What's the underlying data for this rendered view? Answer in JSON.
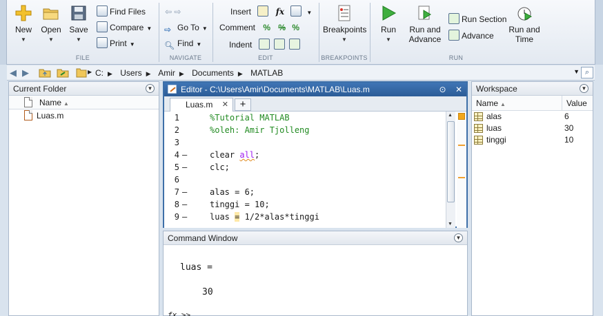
{
  "toolstrip": {
    "file": {
      "label": "FILE",
      "new": "New",
      "open": "Open",
      "save": "Save",
      "find_files": "Find Files",
      "compare": "Compare",
      "print": "Print"
    },
    "navigate": {
      "label": "NAVIGATE",
      "go_to": "Go To",
      "find": "Find"
    },
    "edit": {
      "label": "EDIT",
      "insert": "Insert",
      "comment": "Comment",
      "indent": "Indent",
      "fx": "fx"
    },
    "breakpoints": {
      "label": "BREAKPOINTS",
      "breakpoints": "Breakpoints"
    },
    "run": {
      "label": "RUN",
      "run": "Run",
      "run_and_advance_1": "Run and",
      "run_and_advance_2": "Advance",
      "run_section": "Run Section",
      "advance": "Advance",
      "run_and_time_1": "Run and",
      "run_and_time_2": "Time"
    }
  },
  "address": {
    "crumbs": [
      "C:",
      "Users",
      "Amir",
      "Documents",
      "MATLAB"
    ]
  },
  "current_folder": {
    "title": "Current Folder",
    "column": "Name",
    "files": [
      "Luas.m"
    ]
  },
  "editor": {
    "title": "Editor - C:\\Users\\Amir\\Documents\\MATLAB\\Luas.m",
    "tab": "Luas.m",
    "lines": [
      {
        "n": "1",
        "dash": "",
        "text": "%Tutorial MATLAB",
        "kind": "comment"
      },
      {
        "n": "2",
        "dash": "",
        "text": "%oleh: Amir Tjolleng",
        "kind": "comment"
      },
      {
        "n": "3",
        "dash": "",
        "text": "",
        "kind": "code"
      },
      {
        "n": "4",
        "dash": "–",
        "text": "clear all;",
        "kind": "clear"
      },
      {
        "n": "5",
        "dash": "–",
        "text": "clc;",
        "kind": "code"
      },
      {
        "n": "6",
        "dash": "",
        "text": "",
        "kind": "code"
      },
      {
        "n": "7",
        "dash": "–",
        "text": "alas = 6;",
        "kind": "code"
      },
      {
        "n": "8",
        "dash": "–",
        "text": "tinggi = 10;",
        "kind": "code"
      },
      {
        "n": "9",
        "dash": "–",
        "text": "luas = 1/2*alas*tinggi",
        "kind": "luas"
      }
    ]
  },
  "command_window": {
    "title": "Command Window",
    "output_var": "luas =",
    "output_value": "30",
    "prompt": "fx >>"
  },
  "workspace": {
    "title": "Workspace",
    "col_name": "Name",
    "col_value": "Value",
    "vars": [
      {
        "name": "alas",
        "value": "6"
      },
      {
        "name": "luas",
        "value": "30"
      },
      {
        "name": "tinggi",
        "value": "10"
      }
    ]
  },
  "colors": {
    "editor_title": "#2c5c97",
    "comment": "#228b22",
    "string": "#a020f0",
    "warning": "#f2a71b"
  }
}
